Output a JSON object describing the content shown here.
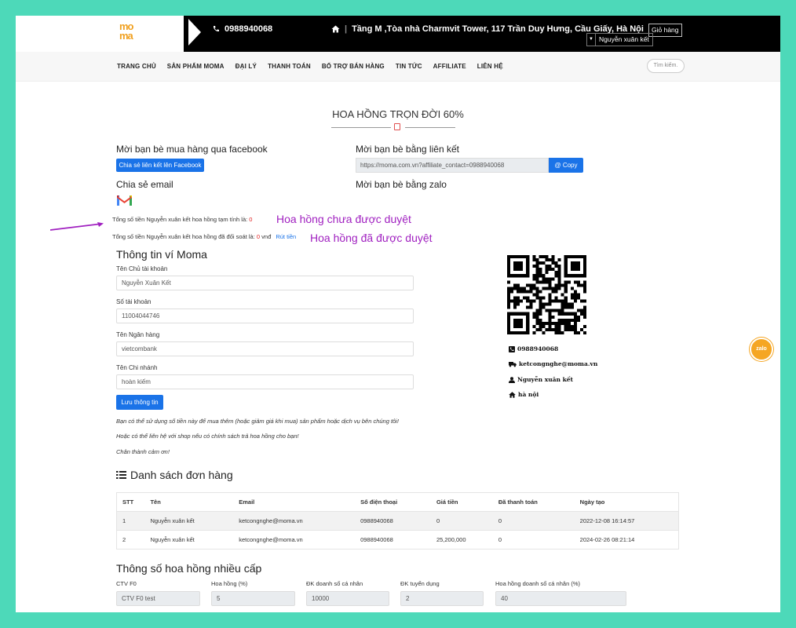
{
  "header": {
    "logo_text": "moma",
    "phone": "0988940068",
    "address": "Tầng M ,Tòa nhà Charmvit Tower, 117 Trần Duy Hưng, Cầu Giấy, Hà Nội",
    "cart_label": "Giỏ hàng",
    "user_name": "Nguyễn xuân kết"
  },
  "nav": {
    "items": [
      "TRANG CHỦ",
      "SẢN PHẨM MOMA",
      "ĐẠI LÝ",
      "THANH TOÁN",
      "BỔ TRỢ BÁN HÀNG",
      "TIN TỨC",
      "AFFILIATE",
      "LIÊN HỆ"
    ],
    "search_placeholder": "Tìm kiếm."
  },
  "page": {
    "title": "HOA HỒNG TRỌN ĐỜI 60%"
  },
  "invite": {
    "facebook_heading": "Mời bạn bè mua hàng qua facebook",
    "facebook_button": "Chia sẻ liên kết lên Facebook",
    "link_heading": "Mời bạn bè bằng liên kết",
    "link_value": "https://moma.com.vn?affiliate_contact=0988940068",
    "copy_button": "Copy",
    "email_heading": "Chia sẻ email",
    "zalo_heading": "Mời bạn bè bằng zalo"
  },
  "commission": {
    "pending_text": "Tổng số tiền Nguyễn xuân kết hoa hồng tạm tính là:",
    "pending_value": "0",
    "approved_text": "Tổng số tiền Nguyễn xuân kết hoa hồng đã đối soát là:",
    "approved_value": "0",
    "approved_unit": "vnđ",
    "withdraw_link": "Rút tiền",
    "annotation_pending": "Hoa hồng chưa được duyệt",
    "annotation_approved": "Hoa hồng đã được duyệt"
  },
  "wallet": {
    "heading": "Thông tin ví Moma",
    "fields": [
      {
        "label": "Tên Chủ tài khoản",
        "value": "Nguyễn Xuân Kết"
      },
      {
        "label": "Số tài khoản",
        "value": "11004044746"
      },
      {
        "label": "Tên Ngân hàng",
        "value": "vietcombank"
      },
      {
        "label": "Tên Chi nhánh",
        "value": "hoàn kiếm"
      }
    ],
    "save_button": "Lưu thông tin",
    "notes": [
      "Bạn có thể sử dụng số tiền này để mua thêm (hoặc giảm giá khi mua) sản phẩm hoặc dịch vụ bên chúng tôi!",
      "Hoặc có thể liên hệ với shop nếu có chính sách trả hoa hồng cho bạn!",
      "Chân thành cảm ơn!"
    ]
  },
  "contact": {
    "phone": "0988940068",
    "email": "ketcongnghe@moma.vn",
    "name": "Nguyễn xuân kết",
    "city": "hà nội"
  },
  "chat_widget_label": "zalo",
  "orders": {
    "heading": "Danh sách đơn hàng",
    "columns": [
      "STT",
      "Tên",
      "Email",
      "Số điện thoại",
      "Giá tiền",
      "Đã thanh toán",
      "Ngày tạo"
    ],
    "rows": [
      [
        "1",
        "Nguyễn xuân kết",
        "ketcongnghe@moma.vn",
        "0988940068",
        "0",
        "0",
        "2022-12-08 16:14:57"
      ],
      [
        "2",
        "Nguyễn xuân kết",
        "ketcongnghe@moma.vn",
        "0988940068",
        "25,200,000",
        "0",
        "2024-02-26 08:21:14"
      ]
    ]
  },
  "levels": {
    "heading": "Thông số hoa hồng nhiều cấp",
    "fields": [
      {
        "label": "CTV F0",
        "value": "CTV F0 test"
      },
      {
        "label": "Hoa hồng (%)",
        "value": "5"
      },
      {
        "label": "ĐK doanh số cá nhân",
        "value": "10000"
      },
      {
        "label": "ĐK tuyển dụng",
        "value": "2"
      },
      {
        "label": "Hoa hồng doanh số cá nhân (%)",
        "value": "40"
      }
    ]
  },
  "colors": {
    "background": "#4dd9b9",
    "primary": "#1a73e8",
    "annotation": "#a020c0",
    "alert": "#e02020"
  }
}
